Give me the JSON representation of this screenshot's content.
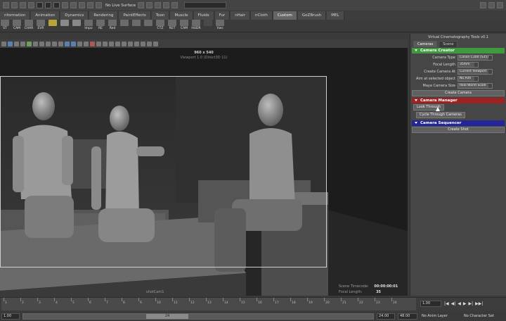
{
  "status_line": {
    "live_surface": "No Live Surface"
  },
  "shelf_tabs": [
    "nformation",
    "Animation",
    "Dynamics",
    "Rendering",
    "PaintEffects",
    "Toon",
    "Muscle",
    "Fluids",
    "Fur",
    "nHair",
    "nCloth",
    "Custom",
    "GoZBrush",
    "MEL"
  ],
  "shelf_tab_active": "Custom",
  "shelf_buttons": [
    "ST",
    "CAM",
    "CHAR",
    "EVR",
    "",
    "",
    "",
    "Impo",
    "RE",
    "Red",
    "",
    "",
    "",
    "CTZ",
    "RET",
    "CAM",
    "HUDR",
    "",
    "Vws"
  ],
  "viewport": {
    "resolution": "960 x 540",
    "subtitle": "Viewport 1.0 (Direct3D 11)",
    "camera_label": "shotCam1",
    "hud": {
      "scene_timecode_label": "Scene Timecode:",
      "scene_timecode_value": "00:00:00:01",
      "focal_length_label": "Focal Length:",
      "focal_length_value": "35"
    }
  },
  "vct_panel": {
    "title": "Virtual Cinematography Tools v0.1",
    "tabs": [
      "Cameras",
      "Scene"
    ],
    "active_tab": "Cameras",
    "camera_creator": {
      "header": "Camera Creator",
      "rows": [
        {
          "label": "Camera Type",
          "value": "Canon C300 (S35)"
        },
        {
          "label": "Focal Length",
          "value": "35mm"
        },
        {
          "label": "Create Camera At",
          "value": "Current Viewport"
        },
        {
          "label": "Aim at selected object",
          "value": "No Aim"
        },
        {
          "label": "Maya Camera Size",
          "value": "Real World Scale"
        }
      ],
      "create_button": "Create Camera"
    },
    "camera_manager": {
      "header": "Camera Manager",
      "look_button": "Look Through",
      "cycle_button": "Cycle Through Cameras"
    },
    "camera_sequencer": {
      "header": "Camera Sequencer",
      "create_shot_button": "Create Shot"
    },
    "colors": {
      "green": "#3f9a3f",
      "red": "#9e2222",
      "blue": "#25259a"
    }
  },
  "timeline": {
    "ticks": [
      "1",
      "2",
      "3",
      "4",
      "5",
      "6",
      "7",
      "8",
      "9",
      "10",
      "11",
      "12",
      "13",
      "14",
      "15",
      "16",
      "17",
      "18",
      "19",
      "20",
      "21",
      "22",
      "23",
      "24"
    ],
    "current_frame": "1.00",
    "controls": [
      "|◀",
      "◀|",
      "◀",
      "▶",
      "▶|",
      "▶▶|"
    ]
  },
  "range": {
    "start": "1.00",
    "inner_start": "1.00",
    "thumb": "24",
    "end": "24.00",
    "anim_end": "48.00",
    "anim_layer": "No Anim Layer",
    "char_set": "No Character Set"
  }
}
